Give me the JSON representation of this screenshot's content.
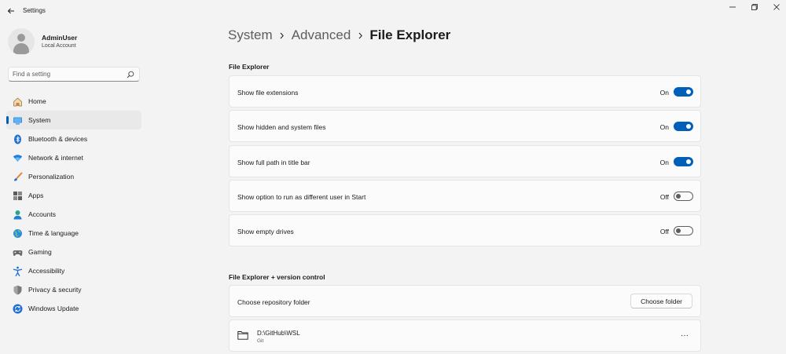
{
  "window": {
    "title": "Settings",
    "controls": {
      "minimize": "minimize-icon",
      "maximize": "restore-icon",
      "close": "close-icon"
    }
  },
  "user": {
    "name": "AdminUser",
    "account_type": "Local Account"
  },
  "search": {
    "placeholder": "Find a setting"
  },
  "sidebar": {
    "items": [
      {
        "label": "Home",
        "icon": "home-icon"
      },
      {
        "label": "System",
        "icon": "system-icon",
        "active": true
      },
      {
        "label": "Bluetooth & devices",
        "icon": "bluetooth-icon"
      },
      {
        "label": "Network & internet",
        "icon": "wifi-icon"
      },
      {
        "label": "Personalization",
        "icon": "brush-icon"
      },
      {
        "label": "Apps",
        "icon": "apps-icon"
      },
      {
        "label": "Accounts",
        "icon": "accounts-icon"
      },
      {
        "label": "Time & language",
        "icon": "globe-icon"
      },
      {
        "label": "Gaming",
        "icon": "gamepad-icon"
      },
      {
        "label": "Accessibility",
        "icon": "accessibility-icon"
      },
      {
        "label": "Privacy & security",
        "icon": "shield-icon"
      },
      {
        "label": "Windows Update",
        "icon": "update-icon"
      }
    ]
  },
  "breadcrumb": {
    "items": [
      "System",
      "Advanced",
      "File Explorer"
    ]
  },
  "file_explorer": {
    "section_title": "File Explorer",
    "settings": [
      {
        "label": "Show file extensions",
        "state": "On"
      },
      {
        "label": "Show hidden and system files",
        "state": "On"
      },
      {
        "label": "Show full path in title bar",
        "state": "On"
      },
      {
        "label": "Show option to run as different user in Start",
        "state": "Off"
      },
      {
        "label": "Show empty drives",
        "state": "Off"
      }
    ]
  },
  "version_control": {
    "section_title": "File Explorer + version control",
    "choose_label": "Choose repository folder",
    "choose_button": "Choose folder",
    "repo": {
      "path": "D:\\GitHub\\WSL",
      "type": "Git",
      "more": "···"
    }
  },
  "colors": {
    "accent": "#005fb8",
    "background": "#f3f3f3",
    "card": "#fbfbfb"
  }
}
